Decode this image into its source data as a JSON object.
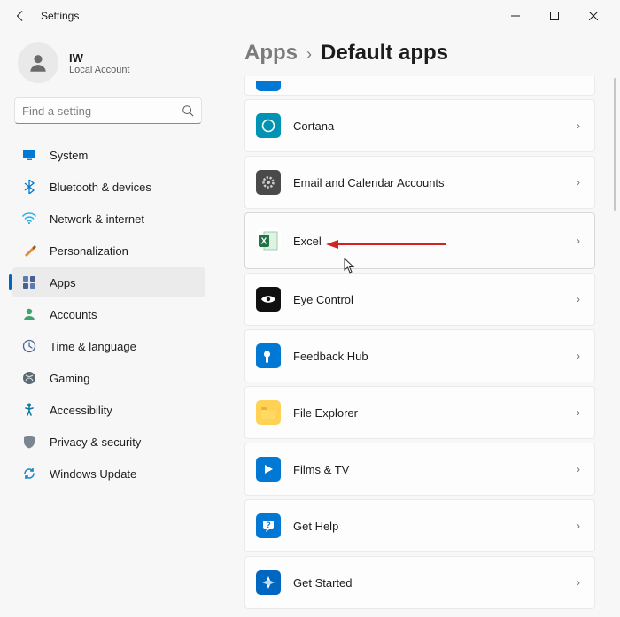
{
  "window": {
    "title": "Settings"
  },
  "account": {
    "name": "IW",
    "type": "Local Account"
  },
  "search": {
    "placeholder": "Find a setting"
  },
  "sidebar": {
    "items": [
      {
        "label": "System"
      },
      {
        "label": "Bluetooth & devices"
      },
      {
        "label": "Network & internet"
      },
      {
        "label": "Personalization"
      },
      {
        "label": "Apps"
      },
      {
        "label": "Accounts"
      },
      {
        "label": "Time & language"
      },
      {
        "label": "Gaming"
      },
      {
        "label": "Accessibility"
      },
      {
        "label": "Privacy & security"
      },
      {
        "label": "Windows Update"
      }
    ],
    "active_index": 4
  },
  "breadcrumb": {
    "parent": "Apps",
    "current": "Default apps"
  },
  "apps": [
    {
      "label": "Cortana"
    },
    {
      "label": "Email and Calendar Accounts"
    },
    {
      "label": "Excel"
    },
    {
      "label": "Eye Control"
    },
    {
      "label": "Feedback Hub"
    },
    {
      "label": "File Explorer"
    },
    {
      "label": "Films & TV"
    },
    {
      "label": "Get Help"
    },
    {
      "label": "Get Started"
    }
  ],
  "colors": {
    "accent": "#0067c0",
    "row_bg": "#fdfdfd",
    "row_border": "#eaeaea",
    "sidebar_active_bg": "#ebebeb",
    "arrow_annotation": "#d62121"
  }
}
